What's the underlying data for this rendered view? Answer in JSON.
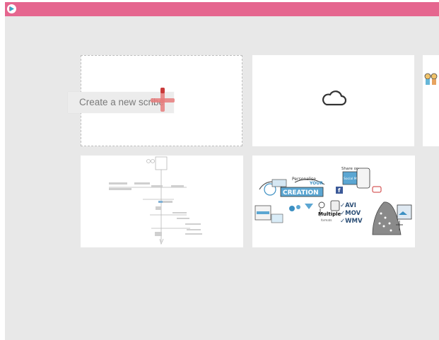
{
  "topbar": {
    "color": "#e5668f"
  },
  "create_card": {
    "label": "Create a new scribe"
  },
  "cards": [
    {
      "kind": "cloud",
      "icon": "cloud-icon"
    },
    {
      "kind": "partial-thumbnail",
      "icon": "people-thumbnail"
    },
    {
      "kind": "sketch-thumbnail",
      "icon": "sketch-flowchart-thumbnail"
    },
    {
      "kind": "sketch-thumbnail",
      "icon": "sketch-features-thumbnail"
    }
  ],
  "sketch2": {
    "personalise": "Personalise",
    "your": "YOUR",
    "creation": "CREATION",
    "share_on": "Share on",
    "social_media": "Social Media",
    "multiple": "Multiple",
    "formats": "formats",
    "avi": "✓AVI",
    "mov": "✓MOV",
    "wmv": "✓WMV"
  }
}
